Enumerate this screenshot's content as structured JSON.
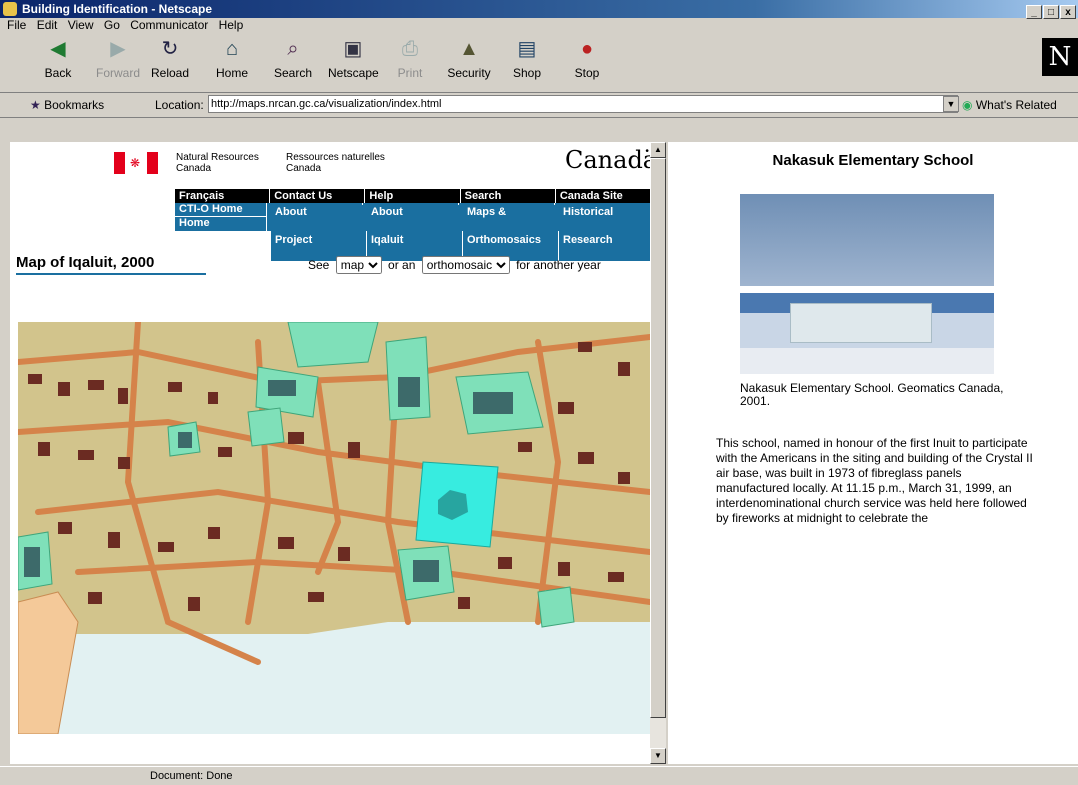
{
  "window": {
    "title": "Building Identification - Netscape",
    "controls": [
      "_",
      "□",
      "x"
    ]
  },
  "menu": [
    "File",
    "Edit",
    "View",
    "Go",
    "Communicator",
    "Help"
  ],
  "toolbar": [
    {
      "label": "Back",
      "icon": "back-arrow-icon",
      "glyph": "◀",
      "enabled": true
    },
    {
      "label": "Forward",
      "icon": "forward-arrow-icon",
      "glyph": "▶",
      "enabled": false
    },
    {
      "label": "Reload",
      "icon": "reload-icon",
      "glyph": "↻",
      "enabled": true
    },
    {
      "label": "Home",
      "icon": "home-icon",
      "glyph": "⌂",
      "enabled": true
    },
    {
      "label": "Search",
      "icon": "search-icon",
      "glyph": "⌕",
      "enabled": true
    },
    {
      "label": "Netscape",
      "icon": "netscape-icon",
      "glyph": "▣",
      "enabled": true
    },
    {
      "label": "Print",
      "icon": "print-icon",
      "glyph": "⎙",
      "enabled": false
    },
    {
      "label": "Security",
      "icon": "lock-icon",
      "glyph": "▲",
      "enabled": true
    },
    {
      "label": "Shop",
      "icon": "shop-icon",
      "glyph": "▤",
      "enabled": true
    },
    {
      "label": "Stop",
      "icon": "stop-icon",
      "glyph": "●",
      "enabled": true
    }
  ],
  "location": {
    "bookmarks": "Bookmarks",
    "label": "Location:",
    "url": "http://maps.nrcan.gc.ca/visualization/index.html",
    "related": "What's Related"
  },
  "status": {
    "text": "Document: Done"
  },
  "left": {
    "dept_en": [
      "Natural Resources",
      "Canada"
    ],
    "dept_fr": [
      "Ressources naturelles",
      "Canada"
    ],
    "wordmark": "Canadä",
    "nav_top": [
      "Français",
      "Contact Us",
      "Help",
      "Search",
      "Canada Site"
    ],
    "nav_bottom": [
      [
        "CTI-O Home",
        "Home"
      ],
      [
        "About",
        "Project"
      ],
      [
        "About",
        "Iqaluit"
      ],
      [
        "Maps &",
        "Orthomosaics"
      ],
      [
        "Historical",
        "Research"
      ]
    ],
    "map_title": "Map of Iqaluit, 2000",
    "see": "See",
    "or_an": "or an",
    "for_year": "for another year",
    "select1": "map",
    "select2": "orthomosaic"
  },
  "right": {
    "title": "Nakasuk Elementary School",
    "caption": "Nakasuk Elementary School. Geomatics Canada, 2001.",
    "body": "This school, named in honour of the first Inuit to participate with the Americans in the siting and building of the Crystal II air base, was built in 1973 of fibreglass panels manufactured locally. At 11.15 p.m., March 31, 1999, an interdenominational church service was held here followed by fireworks at midnight to celebrate the"
  }
}
